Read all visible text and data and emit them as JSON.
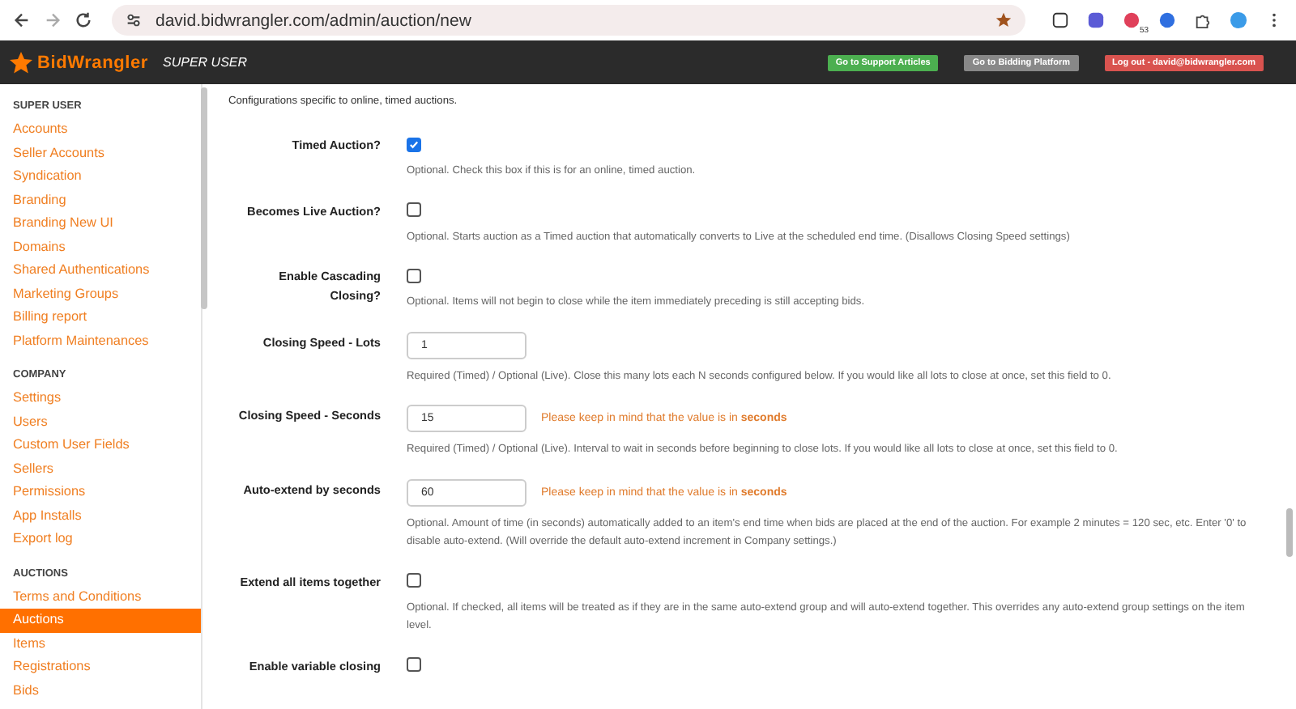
{
  "browser": {
    "url": "david.bidwrangler.com/admin/auction/new",
    "extension_badge": "53"
  },
  "header": {
    "logo": "BidWrangler",
    "role": "SUPER USER",
    "buttons": [
      {
        "label": "Go to Support Articles",
        "color": "#4caf50"
      },
      {
        "label": "Go to Bidding Platform",
        "color": "#888888"
      },
      {
        "label": "Log out - david@bidwrangler.com",
        "color": "#d9534f"
      }
    ]
  },
  "sidebar": {
    "sections": [
      {
        "title": "SUPER USER",
        "items": [
          {
            "label": "Accounts",
            "selected": false
          },
          {
            "label": "Seller Accounts",
            "selected": false
          },
          {
            "label": "Syndication",
            "selected": false
          },
          {
            "label": "Branding",
            "selected": false
          },
          {
            "label": "Branding New UI",
            "selected": false
          },
          {
            "label": "Domains",
            "selected": false
          },
          {
            "label": "Shared Authentications",
            "selected": false
          },
          {
            "label": "Marketing Groups",
            "selected": false
          },
          {
            "label": "Billing report",
            "selected": false
          },
          {
            "label": "Platform Maintenances",
            "selected": false
          }
        ]
      },
      {
        "title": "COMPANY",
        "items": [
          {
            "label": "Settings",
            "selected": false
          },
          {
            "label": "Users",
            "selected": false
          },
          {
            "label": "Custom User Fields",
            "selected": false
          },
          {
            "label": "Sellers",
            "selected": false
          },
          {
            "label": "Permissions",
            "selected": false
          },
          {
            "label": "App Installs",
            "selected": false
          },
          {
            "label": "Export log",
            "selected": false
          }
        ]
      },
      {
        "title": "AUCTIONS",
        "items": [
          {
            "label": "Terms and Conditions",
            "selected": false
          },
          {
            "label": "Auctions",
            "selected": true
          },
          {
            "label": "Items",
            "selected": false
          },
          {
            "label": "Registrations",
            "selected": false
          },
          {
            "label": "Bids",
            "selected": false
          }
        ]
      }
    ]
  },
  "section": {
    "subtitle": "Configurations specific to online, timed auctions."
  },
  "fields": [
    {
      "kind": "checkbox",
      "label": "Timed Auction?",
      "checked": true,
      "help": "Optional. Check this box if this is for an online, timed auction."
    },
    {
      "kind": "checkbox",
      "label": "Becomes Live Auction?",
      "checked": false,
      "help": "Optional. Starts auction as a Timed auction that automatically converts to Live at the scheduled end time. (Disallows Closing Speed settings)"
    },
    {
      "kind": "checkbox",
      "label": "Enable Cascading Closing?",
      "checked": false,
      "help": "Optional. Items will not begin to close while the item immediately preceding is still accepting bids."
    },
    {
      "kind": "text",
      "label": "Closing Speed - Lots",
      "value": "1",
      "help": "Required (Timed) / Optional (Live). Close this many lots each N seconds configured below. If you would like all lots to close at once, set this field to 0."
    },
    {
      "kind": "text",
      "label": "Closing Speed - Seconds",
      "value": "15",
      "note": "Please keep in mind that the value is in **seconds**",
      "help": "Required (Timed) / Optional (Live). Interval to wait in seconds before beginning to close lots. If you would like all lots to close at once, set this field to 0."
    },
    {
      "kind": "text",
      "label": "Auto-extend by seconds",
      "value": "60",
      "note": "Please keep in mind that the value is in **seconds**",
      "help": "Optional. Amount of time (in seconds) automatically added to an item's end time when bids are placed at the end of the auction. For example 2 minutes = 120 sec, etc. Enter '0' to disable auto-extend. (Will override the default auto-extend increment in Company settings.)"
    },
    {
      "kind": "checkbox",
      "label": "Extend all items together",
      "checked": false,
      "help": "Optional. If checked, all items will be treated as if they are in the same auto-extend group and will auto-extend together. This overrides any auto-extend group settings on the item level."
    },
    {
      "kind": "checkbox",
      "label": "Enable variable closing",
      "checked": false
    }
  ]
}
